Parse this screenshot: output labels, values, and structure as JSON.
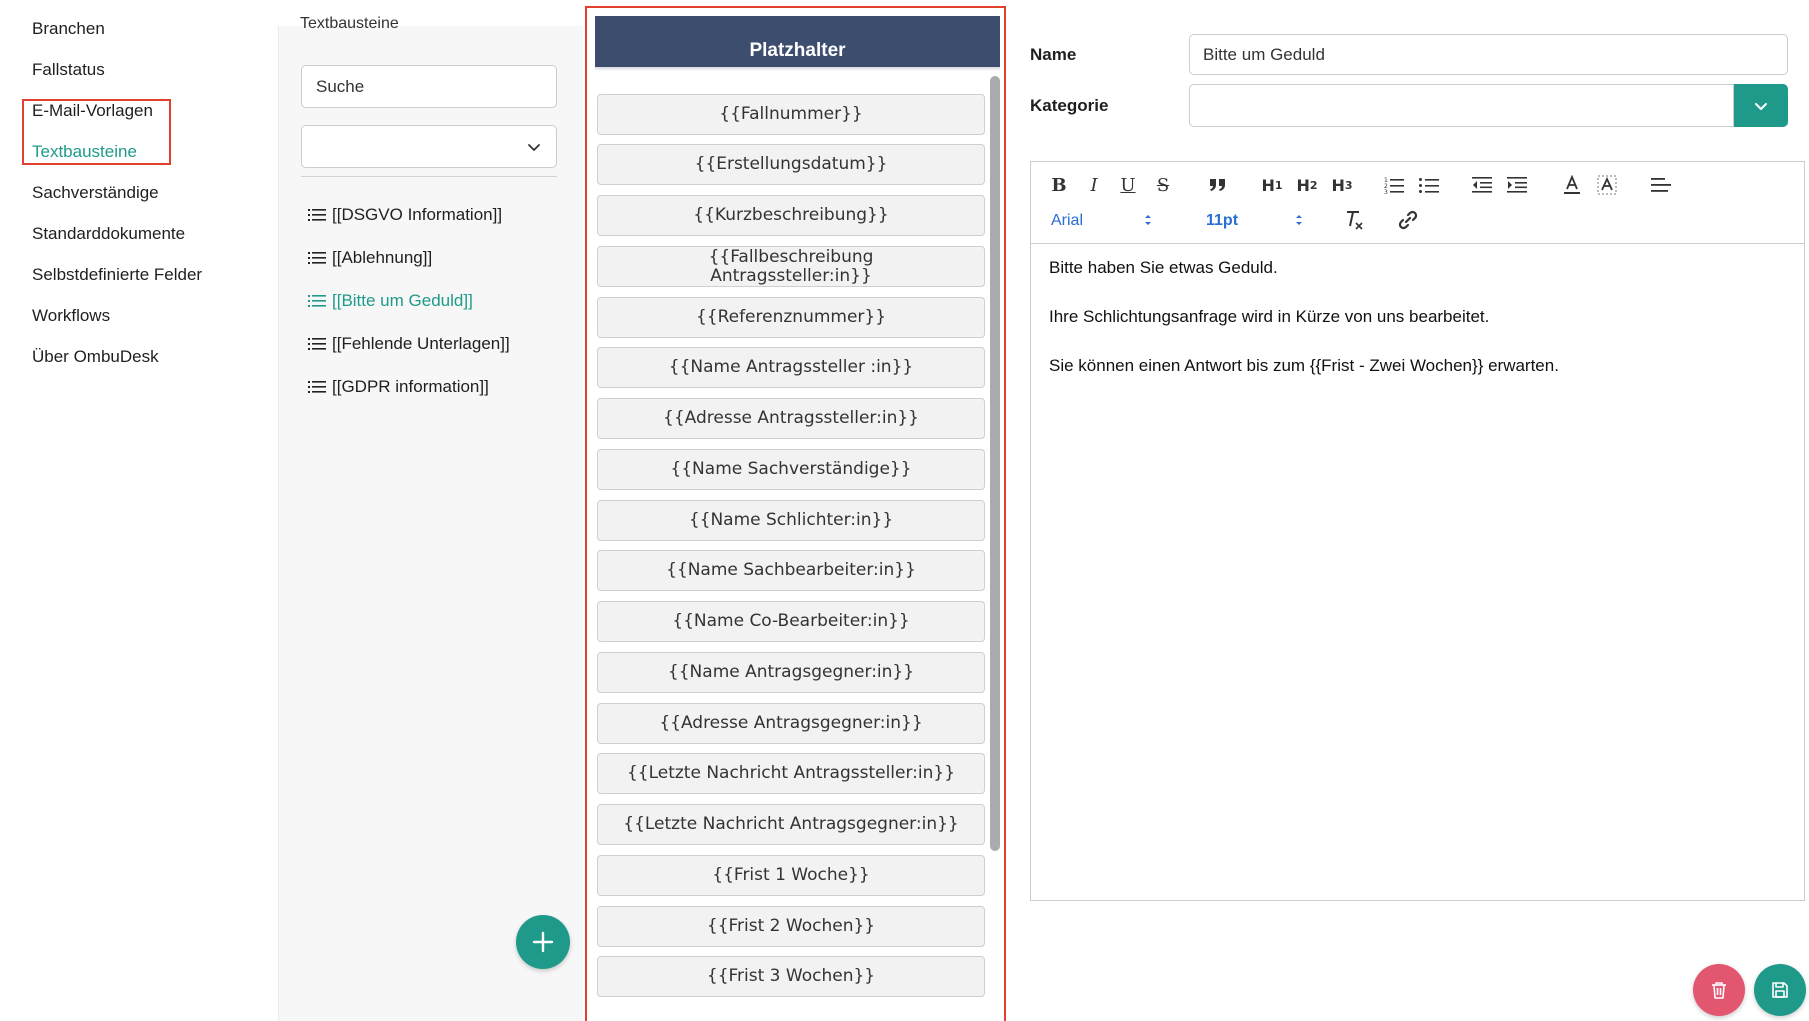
{
  "nav": {
    "items": [
      {
        "label": "Branchen",
        "active": false
      },
      {
        "label": "Fallstatus",
        "active": false
      },
      {
        "label": "E-Mail-Vorlagen",
        "active": false
      },
      {
        "label": "Textbausteine",
        "active": true
      },
      {
        "label": "Sachverständige",
        "active": false
      },
      {
        "label": "Standarddokumente",
        "active": false
      },
      {
        "label": "Selbstdefinierte Felder",
        "active": false
      },
      {
        "label": "Workflows",
        "active": false
      },
      {
        "label": "Über OmbuDesk",
        "active": false
      }
    ]
  },
  "textbausteine": {
    "title": "Textbausteine",
    "search_placeholder": "Suche",
    "filter_value": "",
    "items": [
      {
        "label": "[[DSGVO Information]]",
        "active": false
      },
      {
        "label": "[[Ablehnung]]",
        "active": false
      },
      {
        "label": "[[Bitte um Geduld]]",
        "active": true
      },
      {
        "label": "[[Fehlende Unterlagen]]",
        "active": false
      },
      {
        "label": "[[GDPR information]]",
        "active": false
      }
    ],
    "add_icon": "plus-icon"
  },
  "placeholders": {
    "title": "Platzhalter",
    "items": [
      "{{Fallnummer}}",
      "{{Erstellungsdatum}}",
      "{{Kurzbeschreibung}}",
      "{{Fallbeschreibung Antragssteller:in}}",
      "{{Referenznummer}}",
      "{{Name Antragssteller :in}}",
      "{{Adresse Antragssteller:in}}",
      "{{Name Sachverständige}}",
      "{{Name Schlichter:in}}",
      "{{Name Sachbearbeiter:in}}",
      "{{Name Co-Bearbeiter:in}}",
      "{{Name Antragsgegner:in}}",
      "{{Adresse Antragsgegner:in}}",
      "{{Letzte Nachricht Antragssteller:in}}",
      "{{Letzte Nachricht Antragsgegner:in}}",
      "{{Frist 1 Woche}}",
      "{{Frist 2 Wochen}}",
      "{{Frist 3 Wochen}}"
    ]
  },
  "form": {
    "name_label": "Name",
    "name_value": "Bitte um Geduld",
    "category_label": "Kategorie",
    "category_value": ""
  },
  "editor": {
    "font_family": "Arial",
    "font_size": "11pt",
    "toolbar_icons": [
      "bold-icon",
      "italic-icon",
      "underline-icon",
      "strikethrough-icon",
      "blockquote-icon",
      "heading1-icon",
      "heading2-icon",
      "heading3-icon",
      "ordered-list-icon",
      "bullet-list-icon",
      "outdent-icon",
      "indent-icon",
      "text-color-icon",
      "highlight-color-icon",
      "align-icon",
      "clear-format-icon",
      "link-icon"
    ],
    "paragraphs": [
      "Bitte haben Sie etwas Geduld.",
      "Ihre Schlichtungsanfrage wird in Kürze von uns bearbeitet.",
      "Sie können einen Antwort bis zum {{Frist - Zwei Wochen}} erwarten."
    ]
  },
  "actions": {
    "delete_icon": "trash-icon",
    "save_icon": "save-icon"
  },
  "colors": {
    "accent": "#1f9a8a",
    "header": "#3c4d6e",
    "danger": "#e35670",
    "annotation": "#e2402f",
    "link_blue": "#2a6fd3"
  }
}
